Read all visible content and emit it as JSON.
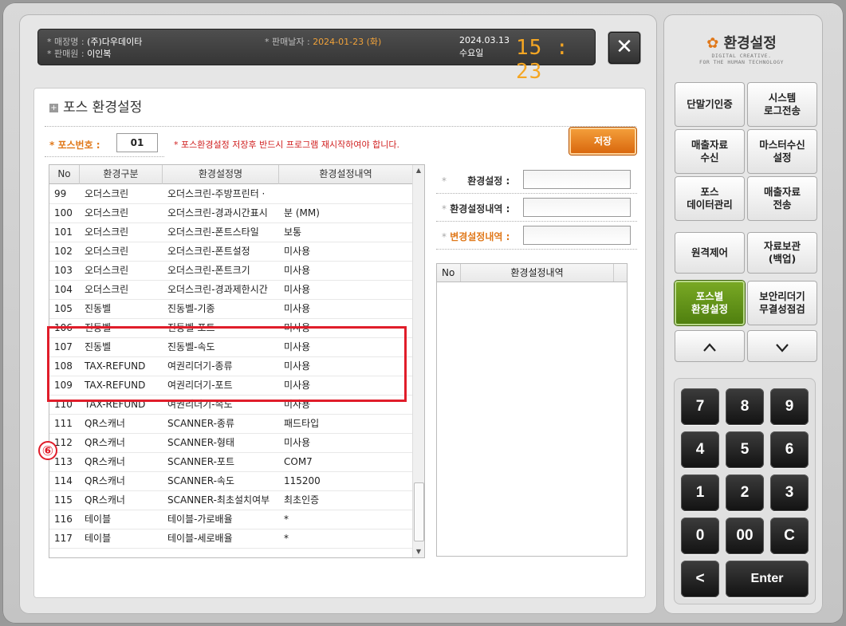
{
  "header": {
    "store_label": "* 매장명 :",
    "store_value": "(주)다우데이타",
    "seller_label": "* 판매원 :",
    "seller_value": "이인복",
    "sale_date_label": "* 판매날자 :",
    "sale_date_value": "2024-01-23 (화)",
    "date": "2024.03.13",
    "weekday": "수요일",
    "time": "15 : 23",
    "close_icon": "close-icon"
  },
  "page": {
    "title": "포스 환경설정",
    "pos_no_label": "* 포스번호 :",
    "pos_no_value": "01",
    "notice": "* 포스환경설정 저장후 반드시 프로그램 재시작하여야 합니다.",
    "save_label": "저장"
  },
  "table": {
    "columns": [
      "No",
      "환경구분",
      "환경설정명",
      "환경설정내역"
    ],
    "rows": [
      [
        "99",
        "오더스크린",
        "오더스크린-주방프린터 ·",
        ""
      ],
      [
        "100",
        "오더스크린",
        "오더스크린-경과시간표시",
        "분 (MM)"
      ],
      [
        "101",
        "오더스크린",
        "오더스크린-폰트스타일",
        "보통"
      ],
      [
        "102",
        "오더스크린",
        "오더스크린-폰트설정",
        "미사용"
      ],
      [
        "103",
        "오더스크린",
        "오더스크린-폰트크기",
        "미사용"
      ],
      [
        "104",
        "오더스크린",
        "오더스크린-경과제한시간",
        "미사용"
      ],
      [
        "105",
        "진동벨",
        "진동벨-기종",
        "미사용"
      ],
      [
        "106",
        "진동벨",
        "진동벨-포트",
        "미사용"
      ],
      [
        "107",
        "진동벨",
        "진동벨-속도",
        "미사용"
      ],
      [
        "108",
        "TAX-REFUND",
        "여권리더기-종류",
        "미사용"
      ],
      [
        "109",
        "TAX-REFUND",
        "여권리더기-포트",
        "미사용"
      ],
      [
        "110",
        "TAX-REFUND",
        "여권리더기-속도",
        "미사용"
      ],
      [
        "111",
        "QR스캐너",
        "SCANNER-종류",
        "패드타입"
      ],
      [
        "112",
        "QR스캐너",
        "SCANNER-형태",
        "미사용"
      ],
      [
        "113",
        "QR스캐너",
        "SCANNER-포트",
        "COM7"
      ],
      [
        "114",
        "QR스캐너",
        "SCANNER-속도",
        "115200"
      ],
      [
        "115",
        "QR스캐너",
        "SCANNER-최초설치여부",
        "최초인증"
      ],
      [
        "116",
        "테이블",
        "테이블-가로배율",
        "*"
      ],
      [
        "117",
        "테이블",
        "테이블-세로배율",
        "*"
      ]
    ]
  },
  "callout": "⑥",
  "settings": {
    "setting_label": "환경설정 :",
    "detail_label": "환경설정내역 :",
    "change_label": "변경설정내역 :",
    "star": "*"
  },
  "sub_table": {
    "columns": [
      "No",
      "환경설정내역"
    ]
  },
  "brand": {
    "title": "환경설정",
    "sub1": "DIGITAL CREATIVE.",
    "sub2": "FOR THE HUMAN TECHNOLOGY"
  },
  "menu": [
    "단말기인증",
    "시스템\n로그전송",
    "매출자료\n수신",
    "마스터수신\n설정",
    "포스\n데이터관리",
    "매출자료\n전송",
    "원격제어",
    "자료보관\n(백업)",
    "포스별\n환경설정",
    "보안리더기\n무결성점검"
  ],
  "keypad": [
    "7",
    "8",
    "9",
    "4",
    "5",
    "6",
    "1",
    "2",
    "3",
    "0",
    "00",
    "C"
  ],
  "keypad_back": "<",
  "keypad_enter": "Enter",
  "colors": {
    "accent_orange": "#e0781a",
    "active_green": "#5d8c14",
    "highlight_red": "#e01d2a"
  }
}
